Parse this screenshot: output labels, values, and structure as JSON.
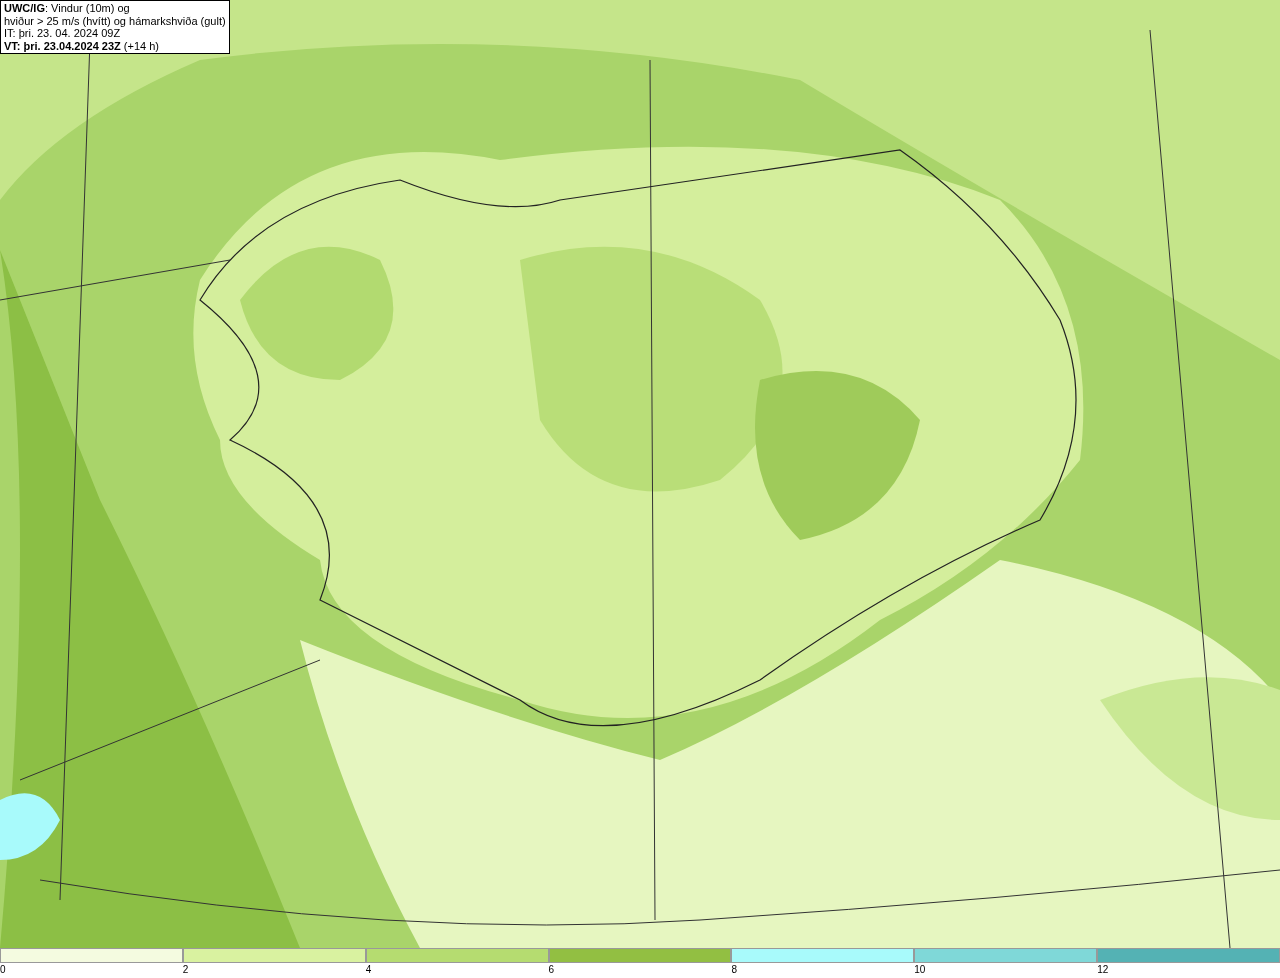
{
  "header": {
    "lines": [
      "**UWC/IG**: Vindur (10m) og",
      "hviður > 25 m/s (hvítt) og hámarkshviða (gult)",
      "IT: þri. 23. 04. 2024 09Z",
      "**VT: þri. 23.04.2024 23Z** (+14 h)"
    ]
  },
  "legend": [
    {
      "label": "0",
      "color": "#f4fbe0"
    },
    {
      "label": "2",
      "color": "#d9f2a0"
    },
    {
      "label": "4",
      "color": "#b5dc70"
    },
    {
      "label": "6",
      "color": "#92bf42"
    },
    {
      "label": "8",
      "color": "#a8fafb"
    },
    {
      "label": "10",
      "color": "#7fd8d8"
    },
    {
      "label": "12",
      "color": "#54b2b4"
    }
  ]
}
